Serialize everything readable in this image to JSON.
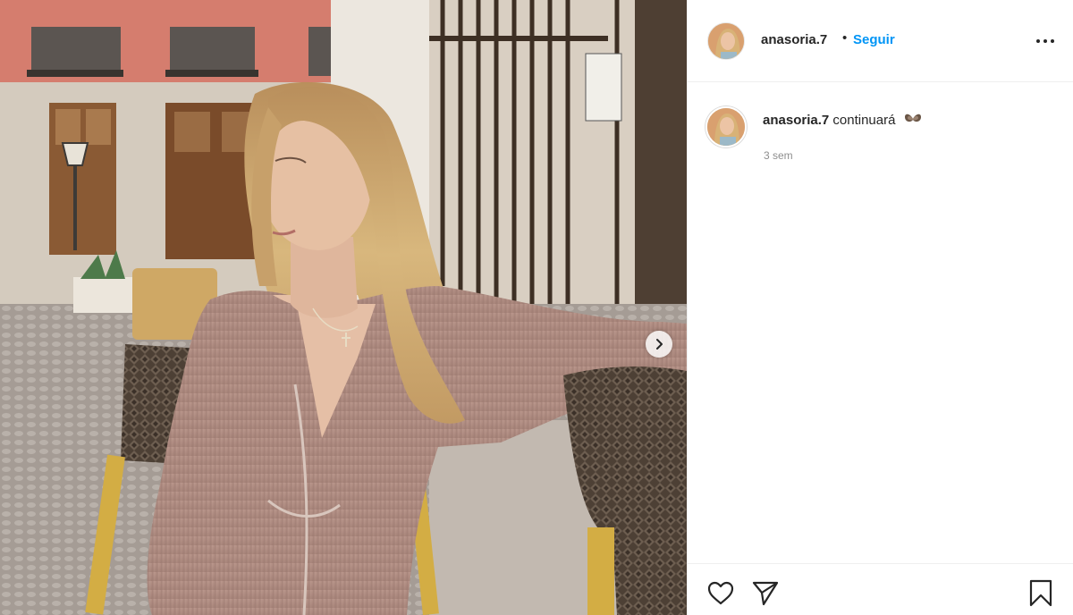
{
  "post": {
    "username": "anasoria.7",
    "separator": "•",
    "follow_label": "Seguir",
    "more_icon": "more-options-icon",
    "caption": {
      "username": "anasoria.7",
      "text": "continuará",
      "emoji_icon": "butterfly-emoji-icon"
    },
    "time_ago": "3 sem"
  },
  "photo": {
    "next_icon": "chevron-right-icon",
    "description_colors": {
      "wall": "#d57d6e",
      "dress": "#b08c82",
      "hair": "#c9a66d",
      "chair": "#5a4c40"
    }
  },
  "actions": {
    "like_icon": "heart-icon",
    "share_icon": "paper-plane-icon",
    "save_icon": "bookmark-icon"
  }
}
